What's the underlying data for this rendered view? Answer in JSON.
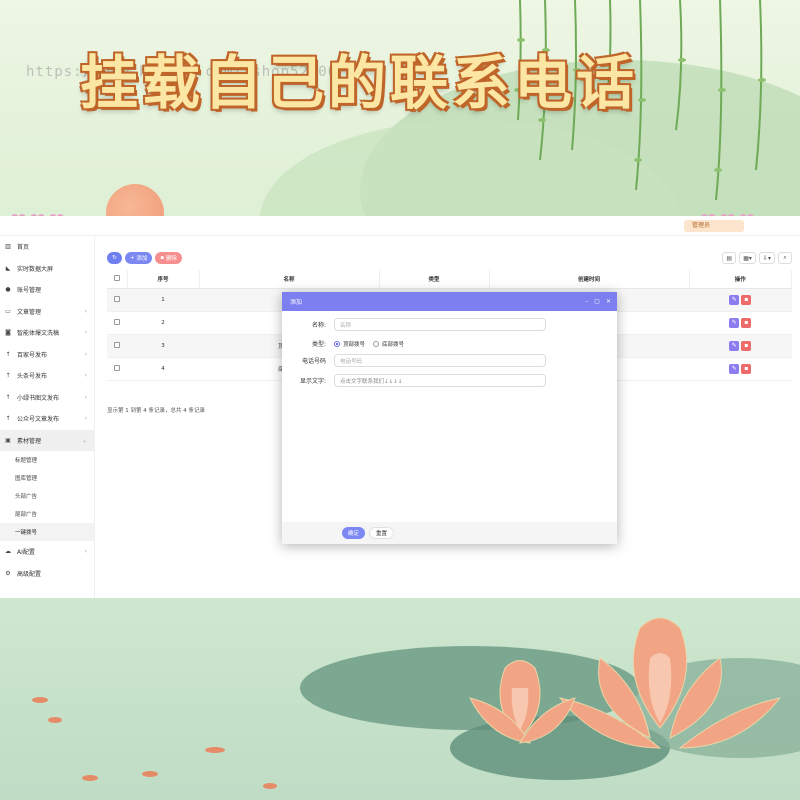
{
  "banner": {
    "title": "挂载自己的联系电话",
    "watermark": "https://www.huzhan.com/ishop52806"
  },
  "topbar": {
    "user_label": "管理员"
  },
  "sidebar": {
    "items": [
      {
        "label": "首页",
        "icon": "chart-icon",
        "has_arrow": false
      },
      {
        "label": "实时数据大屏",
        "icon": "area-chart-icon",
        "has_arrow": false
      },
      {
        "label": "账号管理",
        "icon": "users-icon",
        "has_arrow": false
      },
      {
        "label": "文章管理",
        "icon": "folder-icon",
        "has_arrow": true
      },
      {
        "label": "智能体爆文洗稿",
        "icon": "robot-icon",
        "has_arrow": true
      },
      {
        "label": "百家号发布",
        "icon": "upload-icon",
        "has_arrow": true
      },
      {
        "label": "头条号发布",
        "icon": "upload-icon",
        "has_arrow": true
      },
      {
        "label": "小绿书图文发布",
        "icon": "upload-icon",
        "has_arrow": true
      },
      {
        "label": "公众号文章发布",
        "icon": "upload-icon",
        "has_arrow": true
      },
      {
        "label": "素材管理",
        "icon": "image-icon",
        "has_arrow": true
      }
    ],
    "sub_items": [
      "标题管理",
      "图库管理",
      "头部广告",
      "尾部广告",
      "一键拨号"
    ],
    "bottom_items": [
      {
        "label": "AI配置",
        "icon": "cloud-icon",
        "has_arrow": true
      },
      {
        "label": "高级配置",
        "icon": "gear-icon",
        "has_arrow": false
      }
    ]
  },
  "toolbar": {
    "add_label": "添加",
    "delete_label": "删除"
  },
  "table": {
    "columns": [
      "序号",
      "名称",
      "类型",
      "创建时间",
      "操作"
    ],
    "rows": [
      {
        "seq": "1",
        "name": "咨..."
      },
      {
        "seq": "2",
        "name": "咨..."
      },
      {
        "seq": "3",
        "name": "顶部拨..."
      },
      {
        "seq": "4",
        "name": "底部拨..."
      }
    ],
    "footer": "显示第 1 到第 4 条记录，总共 4 条记录"
  },
  "modal": {
    "title": "添加",
    "fields": {
      "name_label": "名称:",
      "name_placeholder": "名称",
      "type_label": "类型:",
      "type_options": [
        "顶部拨号",
        "底部拨号"
      ],
      "type_selected": "顶部拨号",
      "phone_label": "电话号码",
      "phone_placeholder": "电话号码",
      "display_label": "显示文字:",
      "display_value": "点击文字联系我们↓↓↓↓"
    },
    "confirm_label": "确定",
    "reset_label": "重置"
  },
  "colors": {
    "accent": "#7b7fef",
    "danger": "#ee6b6b",
    "banner_text": "#fbe7a3",
    "banner_outline": "#c0652a"
  }
}
